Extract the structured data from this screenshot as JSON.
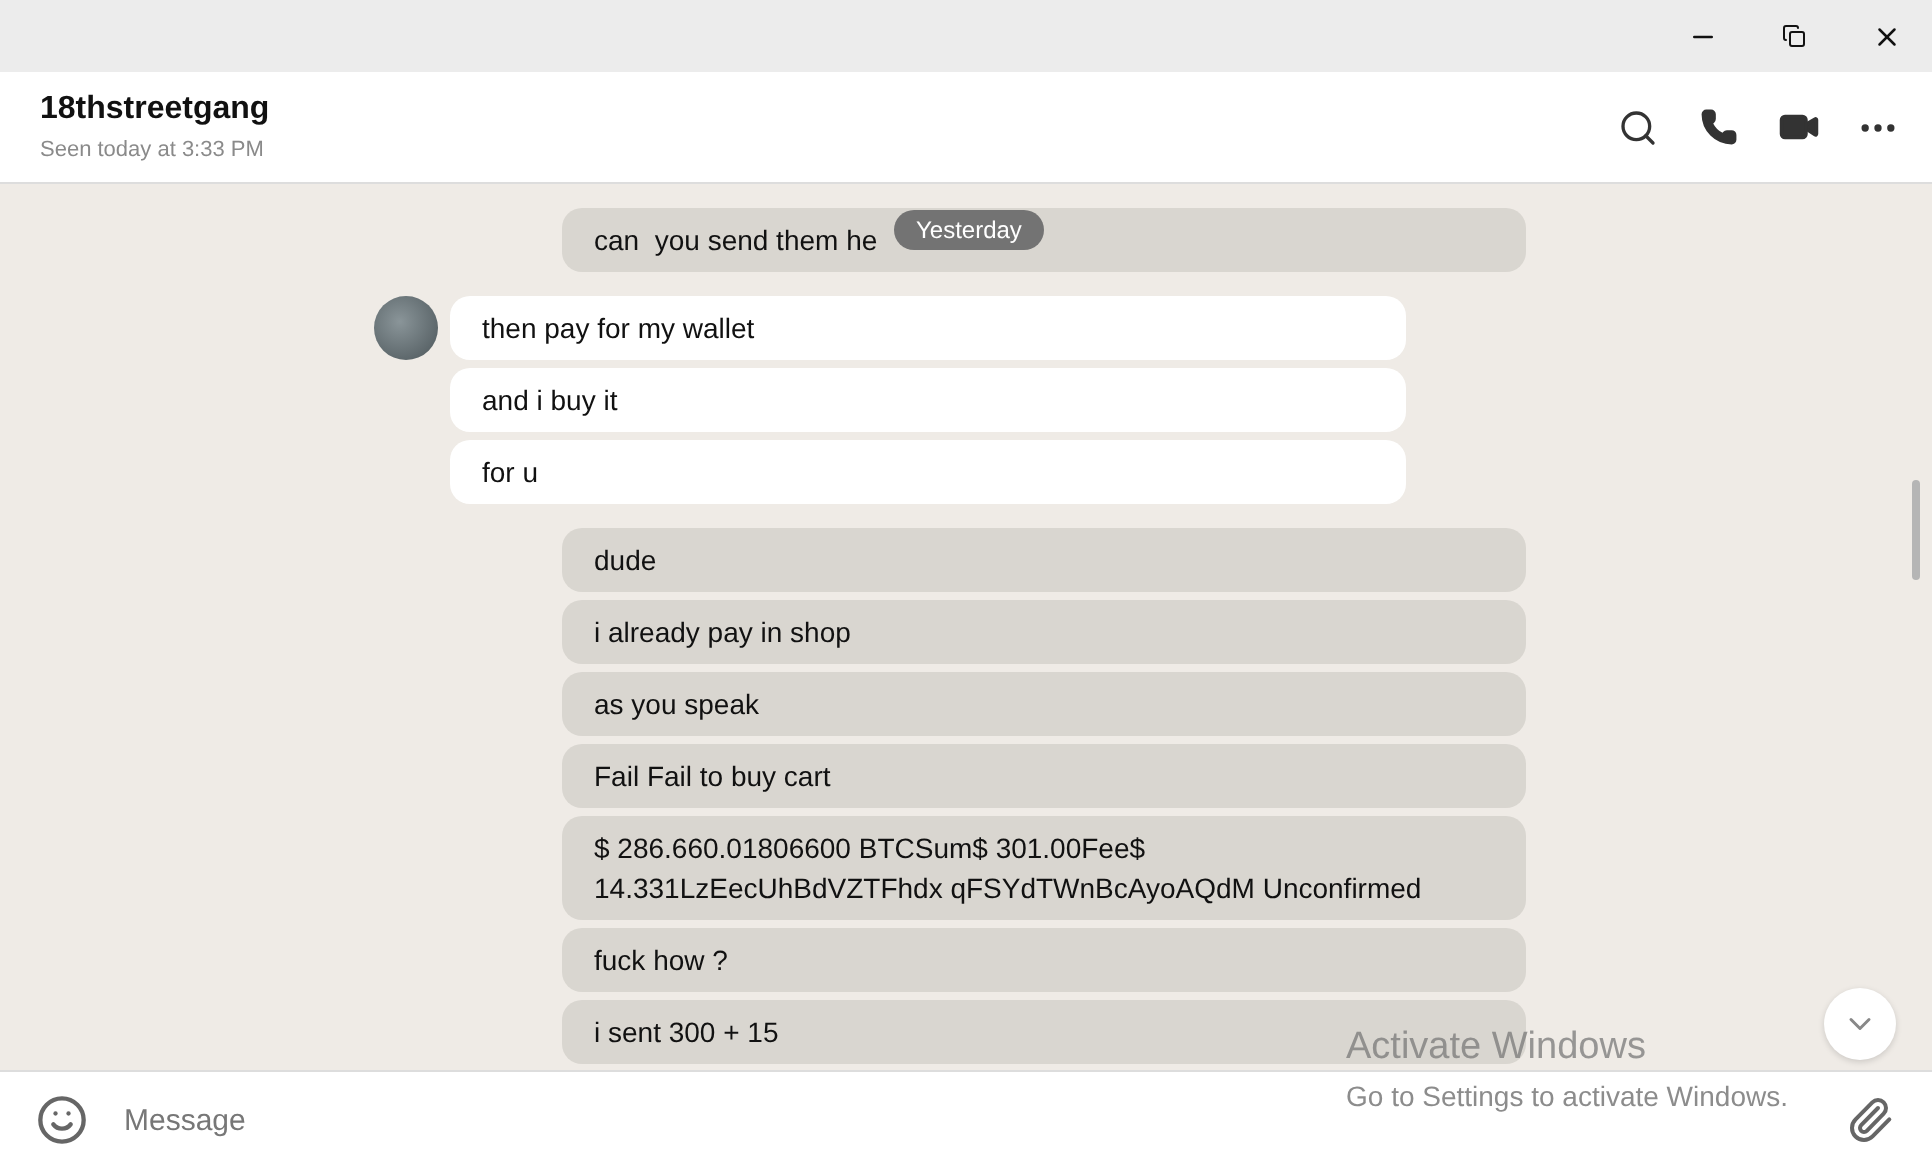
{
  "chat": {
    "name": "18thstreetgang",
    "status": "Seen today at 3:33 PM"
  },
  "date_badge": "Yesterday",
  "groups": [
    {
      "kind": "out",
      "messages": [
        "can  you send them he"
      ]
    },
    {
      "kind": "in",
      "messages": [
        "then pay for my wallet",
        "and i buy it",
        "for u"
      ]
    },
    {
      "kind": "out",
      "messages": [
        "dude",
        "i already pay in shop",
        "as you speak",
        "Fail Fail to buy cart",
        "$ 286.660.01806600 BTCSum$ 301.00Fee$ 14.331LzEecUhBdVZTFhdx qFSYdTWnBcAyoAQdM Unconfirmed",
        "fuck how ?",
        "i sent 300 + 15"
      ]
    }
  ],
  "composer": {
    "placeholder": "Message"
  },
  "os_notice": {
    "title": "Activate Windows",
    "text": "Go to Settings to activate Windows."
  }
}
